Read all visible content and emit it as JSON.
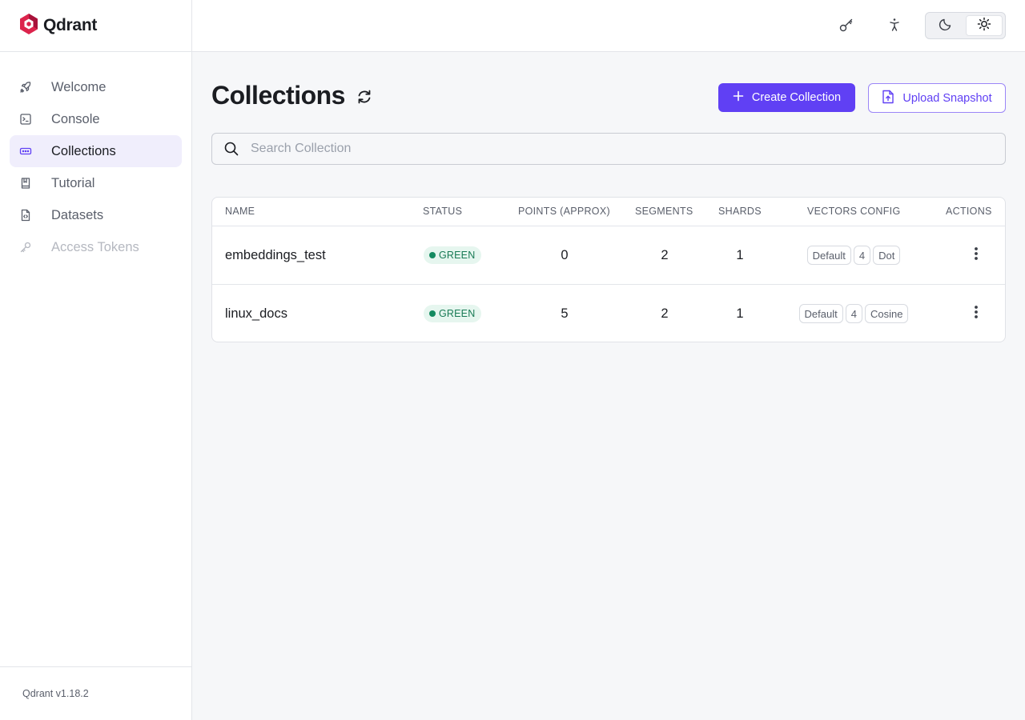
{
  "brand": {
    "name": "Qdrant",
    "version": "Qdrant v1.18.2",
    "logo_color": "#dc244c"
  },
  "sidebar": {
    "items": [
      {
        "label": "Welcome",
        "icon": "rocket-icon"
      },
      {
        "label": "Console",
        "icon": "terminal-icon"
      },
      {
        "label": "Collections",
        "icon": "collections-icon",
        "active": true
      },
      {
        "label": "Tutorial",
        "icon": "book-icon"
      },
      {
        "label": "Datasets",
        "icon": "dataset-file-icon"
      },
      {
        "label": "Access Tokens",
        "icon": "key-icon",
        "disabled": true
      }
    ]
  },
  "topbar": {
    "icons": [
      "key-icon",
      "accessibility-icon"
    ],
    "theme": {
      "options": [
        "moon-icon",
        "sun-icon"
      ],
      "selected": "sun-icon"
    }
  },
  "main": {
    "title": "Collections",
    "create_label": "Create Collection",
    "upload_label": "Upload Snapshot",
    "search": {
      "placeholder": "Search Collection",
      "value": ""
    },
    "table": {
      "headers": [
        "NAME",
        "STATUS",
        "POINTS (APPROX)",
        "SEGMENTS",
        "SHARDS",
        "VECTORS CONFIG",
        "ACTIONS"
      ],
      "rows": [
        {
          "name": "embeddings_test",
          "status": "GREEN",
          "points": "0",
          "segments": "2",
          "shards": "1",
          "vectors": [
            "Default",
            "4",
            "Dot"
          ]
        },
        {
          "name": "linux_docs",
          "status": "GREEN",
          "points": "5",
          "segments": "2",
          "shards": "1",
          "vectors": [
            "Default",
            "4",
            "Cosine"
          ]
        }
      ]
    }
  },
  "colors": {
    "accent": "#6040f4",
    "status_green": "#148a60",
    "active_bg": "#f0eefc"
  }
}
